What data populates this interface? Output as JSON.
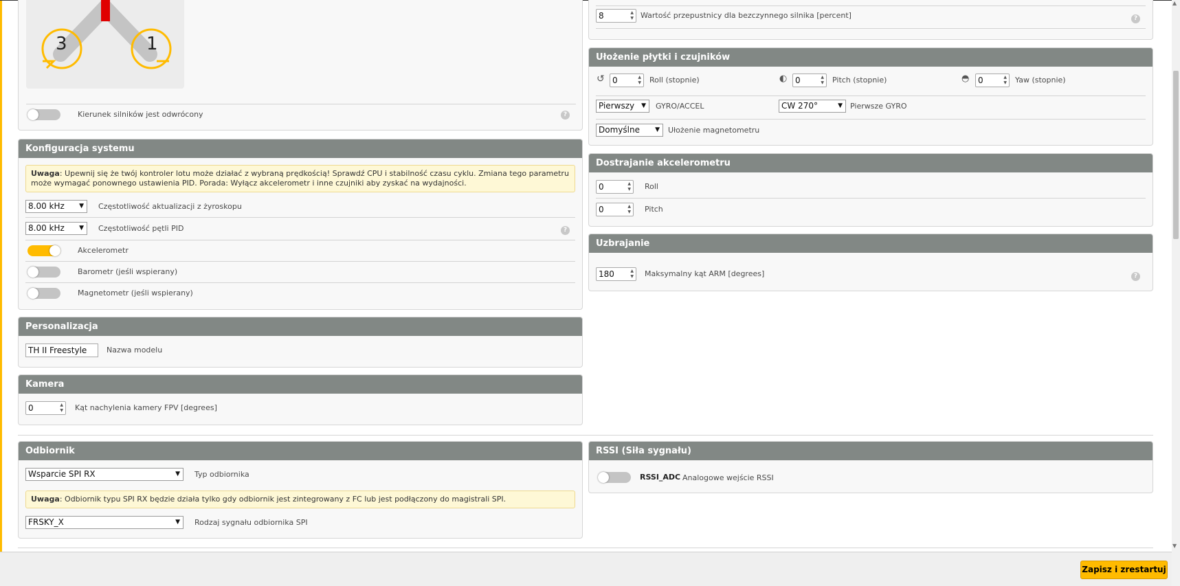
{
  "motor_panel": {
    "motor_3": "3",
    "motor_1": "1",
    "reversed_label": "Kierunek silników jest odwrócony"
  },
  "system": {
    "title": "Konfiguracja systemu",
    "warning_bold": "Uwaga",
    "warning_text": ": Upewnij się że twój kontroler lotu może działać z wybraną prędkością! Sprawdź CPU i stabilność czasu cyklu. Zmiana tego parametru może wymagać ponownego ustawienia PID. Porada: Wyłącz akcelerometr i inne czujniki aby zyskać na wydajności.",
    "gyro_freq_value": "8.00 kHz",
    "gyro_freq_label": "Częstotliwość aktualizacji z żyroskopu",
    "pid_freq_value": "8.00 kHz",
    "pid_freq_label": "Częstotliwość pętli PID",
    "accel_label": "Akcelerometr",
    "baro_label": "Barometr (jeśli wspierany)",
    "mag_label": "Magnetometr (jeśli wspierany)"
  },
  "personal": {
    "title": "Personalizacja",
    "model_name_value": "TH II Freestyle",
    "model_name_label": "Nazwa modelu"
  },
  "camera": {
    "title": "Kamera",
    "angle_value": "0",
    "angle_label": "Kąt nachylenia kamery FPV [degrees]"
  },
  "receiver": {
    "title": "Odbiornik",
    "type_value": "Wsparcie SPI RX",
    "type_label": "Typ odbiornika",
    "note_bold": "Uwaga",
    "note_text": ": Odbiornik typu SPI RX będzie działa tylko gdy odbiornik jest zintegrowany z FC lub jest podłączony do magistrali SPI.",
    "spi_value": "FRSKY_X",
    "spi_label": "Rodzaj sygnału odbiornika SPI"
  },
  "throttle": {
    "idle_value": "8",
    "idle_label": "Wartość przepustnicy dla bezczynnego silnika [percent]"
  },
  "board": {
    "title": "Ułożenie płytki i czujników",
    "roll_value": "0",
    "roll_label": "Roll (stopnie)",
    "pitch_value": "0",
    "pitch_label": "Pitch (stopnie)",
    "yaw_value": "0",
    "yaw_label": "Yaw (stopnie)",
    "gyro_select": "Pierwszy",
    "gyro_label": "GYRO/ACCEL",
    "gyro_align": "CW 270°",
    "gyro_align_label": "Pierwsze GYRO",
    "mag_select": "Domyślne",
    "mag_label": "Ułożenie magnetometru"
  },
  "acc_trim": {
    "title": "Dostrajanie akcelerometru",
    "roll_value": "0",
    "roll_label": "Roll",
    "pitch_value": "0",
    "pitch_label": "Pitch"
  },
  "arming": {
    "title": "Uzbrajanie",
    "angle_value": "180",
    "angle_label": "Maksymalny kąt ARM [degrees]"
  },
  "rssi": {
    "title": "RSSI (Siła sygnału)",
    "adc_bold": "RSSI_ADC",
    "adc_label": "Analogowe wejście RSSI"
  },
  "footer": {
    "save_label": "Zapisz i zrestartuj"
  },
  "icons": {
    "help": "?",
    "select_arrow": "▼",
    "spin_up": "▲",
    "spin_down": "▼"
  },
  "colors": {
    "accent": "#ffbb00",
    "panel_header": "#828885",
    "motor_arm": "#c4c4c4",
    "motor_front": "#e00000"
  }
}
